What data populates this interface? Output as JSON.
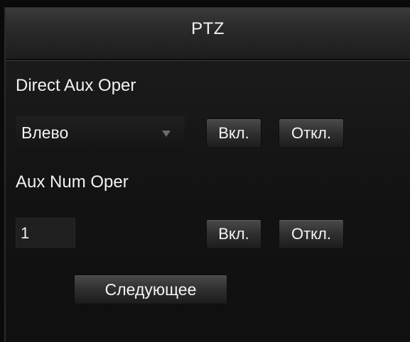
{
  "window": {
    "title": "PTZ"
  },
  "direct_aux": {
    "label": "Direct Aux Oper",
    "select_value": "Влево",
    "on_label": "Вкл.",
    "off_label": "Откл."
  },
  "aux_num": {
    "label": "Aux Num Oper",
    "input_value": "1",
    "on_label": "Вкл.",
    "off_label": "Откл."
  },
  "footer": {
    "next_label": "Следующее"
  },
  "colors": {
    "background": "#121212",
    "titlebar": "#2a2a2a",
    "text": "#f2f2f2",
    "button": "#333333"
  },
  "icons": {
    "dropdown_arrow": "chevron-down-icon"
  }
}
